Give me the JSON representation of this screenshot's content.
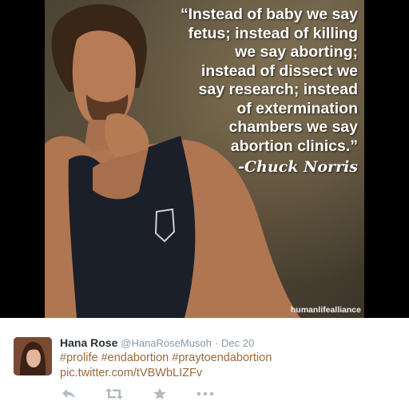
{
  "media": {
    "quote": "“Instead of baby we say fetus; instead of killing we say aborting; instead of dissect we say research; instead of extermination chambers we say abortion clinics.”",
    "quote_lines": [
      "“Instead of baby we say",
      "fetus; instead of killing",
      "we say aborting;",
      "instead of dissect we",
      "say research; instead",
      "of extermination",
      "chambers we say",
      "abortion clinics.”"
    ],
    "attribution": "-Chuck Norris",
    "watermark": "humanlifealliance"
  },
  "tweet": {
    "author_name": "Hana Rose",
    "author_handle": "@HanaRoseMusoh",
    "separator": "·",
    "date": "Dec 20",
    "hashtags": [
      "#prolife",
      "#endabortion",
      "#praytoendabortion"
    ],
    "link": "pic.twitter.com/tVBWbLIZFv",
    "actions": [
      {
        "name": "reply-icon"
      },
      {
        "name": "retweet-icon"
      },
      {
        "name": "favorite-icon"
      },
      {
        "name": "more-icon"
      }
    ],
    "colors": {
      "hashtag": "#9c6a3b",
      "muted": "#8899a6",
      "action": "#b1bbc3"
    }
  }
}
